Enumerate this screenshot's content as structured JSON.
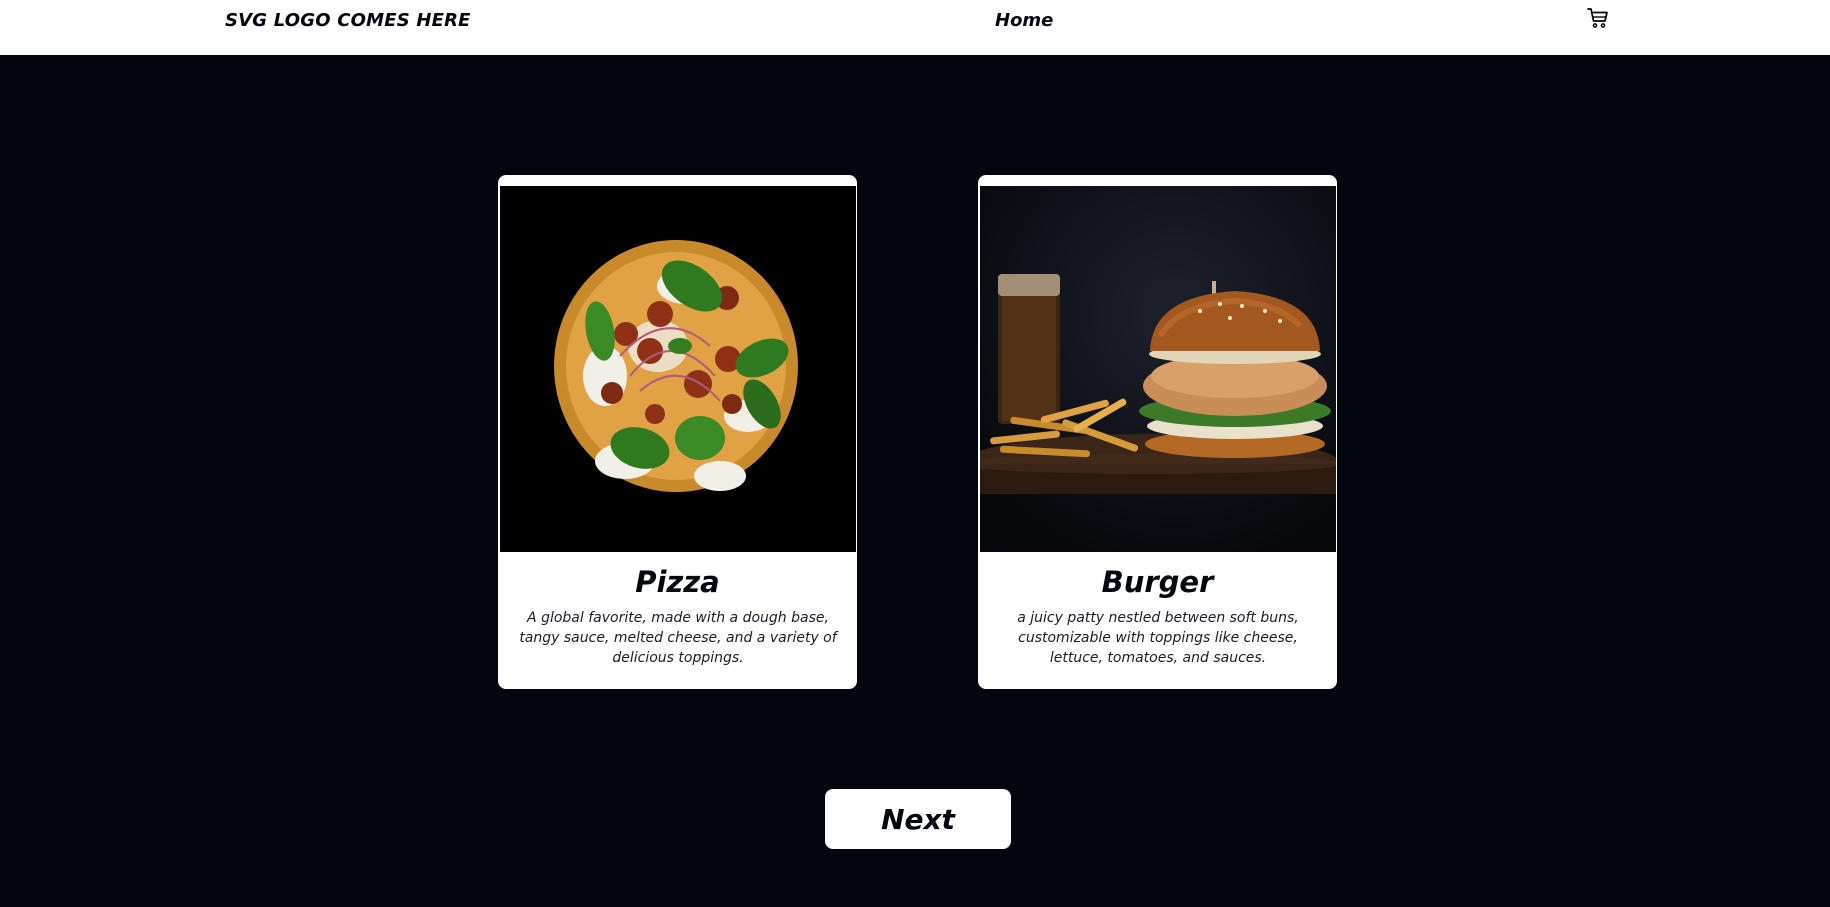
{
  "header": {
    "logo_text": "SVG LOGO COMES HERE",
    "nav_home": "Home",
    "cart_icon": "shopping-cart-icon"
  },
  "cards": [
    {
      "title": "Pizza",
      "description": "A global favorite, made with a dough base, tangy sauce, melted cheese, and a variety of delicious toppings.",
      "image": "pizza-photo"
    },
    {
      "title": "Burger",
      "description": "a juicy patty nestled between soft buns, customizable with toppings like cheese, lettuce, tomatoes, and sauces.",
      "image": "burger-photo"
    }
  ],
  "next_label": "Next",
  "colors": {
    "background": "#03060f",
    "card": "#ffffff",
    "text": "#03060f"
  }
}
